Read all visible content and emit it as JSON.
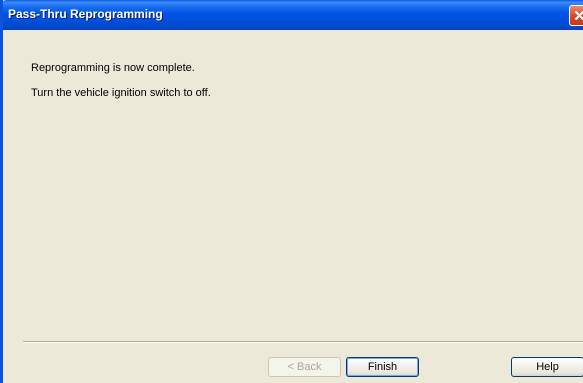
{
  "window": {
    "title": "Pass-Thru Reprogramming"
  },
  "message": {
    "line1": "Reprogramming is now complete.",
    "line2": "Turn the vehicle ignition switch to off."
  },
  "buttons": {
    "back_label": "< Back",
    "finish_label": "Finish",
    "help_label": "Help"
  },
  "icons": {
    "close": "close-icon"
  },
  "colors": {
    "titlebar": "#0054e3",
    "dialog_background": "#ece9d8",
    "close_button": "#d4502a"
  }
}
